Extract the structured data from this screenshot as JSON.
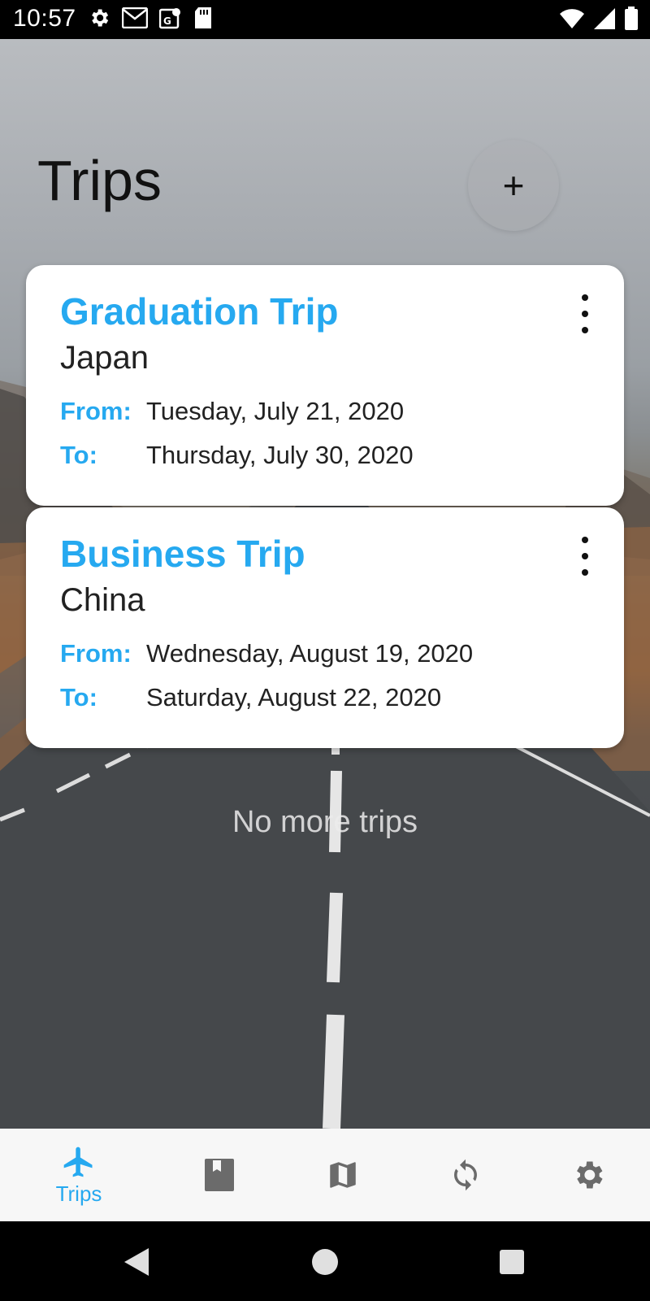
{
  "status_bar": {
    "time": "10:57",
    "left_icons": [
      "settings-icon",
      "gmail-icon",
      "maps-icon",
      "sd-card-icon"
    ],
    "right_icons": [
      "wifi-icon",
      "signal-icon",
      "battery-icon"
    ]
  },
  "header": {
    "title": "Trips",
    "add_label": "+"
  },
  "trips": [
    {
      "title": "Graduation Trip",
      "destination": "Japan",
      "from_label": "From:",
      "from_value": "Tuesday, July 21, 2020",
      "to_label": "To:",
      "to_value": "Thursday, July 30, 2020"
    },
    {
      "title": "Business Trip",
      "destination": "China",
      "from_label": "From:",
      "from_value": "Wednesday, August 19, 2020",
      "to_label": "To:",
      "to_value": "Saturday, August 22, 2020"
    }
  ],
  "empty_message": "No more trips",
  "bottom_nav": {
    "items": [
      {
        "icon": "airplane-icon",
        "label": "Trips",
        "active": true
      },
      {
        "icon": "book-icon",
        "label": "",
        "active": false
      },
      {
        "icon": "map-icon",
        "label": "",
        "active": false
      },
      {
        "icon": "sync-icon",
        "label": "",
        "active": false
      },
      {
        "icon": "gear-icon",
        "label": "",
        "active": false
      }
    ]
  },
  "colors": {
    "accent": "#26a9f0",
    "inactive_icon": "#6b6b6b"
  }
}
